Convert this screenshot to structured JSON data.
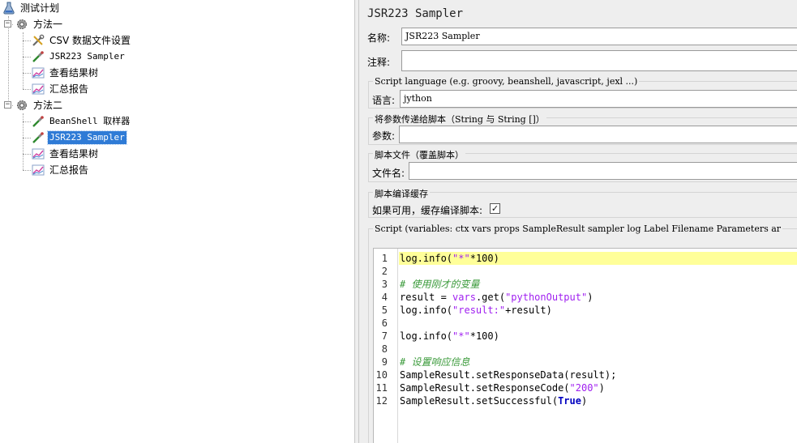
{
  "tree": {
    "root": {
      "label": "测试计划",
      "icon": "flask-icon"
    },
    "groups": [
      {
        "label": "方法一",
        "icon": "gear-icon",
        "expanded": true,
        "children": [
          {
            "label": "CSV 数据文件设置",
            "icon": "wrench-scissors-icon"
          },
          {
            "label": "JSR223 Sampler",
            "icon": "pipette-icon"
          },
          {
            "label": "查看结果树",
            "icon": "graph-icon"
          },
          {
            "label": "汇总报告",
            "icon": "graph-icon"
          }
        ]
      },
      {
        "label": "方法二",
        "icon": "gear-icon",
        "expanded": true,
        "children": [
          {
            "label": "BeanShell 取样器",
            "icon": "pipette-icon"
          },
          {
            "label": "JSR223 Sampler",
            "icon": "pipette-icon",
            "selected": true
          },
          {
            "label": "查看结果树",
            "icon": "graph-icon"
          },
          {
            "label": "汇总报告",
            "icon": "graph-icon"
          }
        ]
      }
    ]
  },
  "panel": {
    "title": "JSR223 Sampler",
    "name_label": "名称:",
    "name_value": "JSR223 Sampler",
    "comment_label": "注释:",
    "comment_value": "",
    "script_language_title": "Script language (e.g. groovy, beanshell, javascript, jexl ...)",
    "language_label": "语言:",
    "language_value": "jython",
    "params_title": "将参数传递给脚本（String 与 String []）",
    "params_label": "参数:",
    "params_value": "",
    "script_file_title": "脚本文件（覆盖脚本）",
    "file_label": "文件名:",
    "file_value": "",
    "cache_title": "脚本编译缓存",
    "cache_label": "如果可用，缓存编译脚本:",
    "cache_checked": true,
    "script_title": "Script (variables: ctx vars props SampleResult sampler log Label Filename Parameters ar"
  },
  "editor": {
    "current_line": 1,
    "line_numbers": [
      "1",
      "2",
      "3",
      "4",
      "5",
      "6",
      "7",
      "8",
      "9",
      "10",
      "11",
      "12"
    ],
    "lines": [
      [
        {
          "t": "pl",
          "v": "log.info("
        },
        {
          "t": "str",
          "v": "\"*\""
        },
        {
          "t": "pl",
          "v": "*100)"
        }
      ],
      [],
      [
        {
          "t": "cmt",
          "v": "# 使用刚才的变量"
        }
      ],
      [
        {
          "t": "pl",
          "v": "result = "
        },
        {
          "t": "str",
          "v": "vars"
        },
        {
          "t": "pl",
          "v": ".get("
        },
        {
          "t": "str",
          "v": "\"pythonOutput\""
        },
        {
          "t": "pl",
          "v": ")"
        }
      ],
      [
        {
          "t": "pl",
          "v": "log.info("
        },
        {
          "t": "str",
          "v": "\"result:\""
        },
        {
          "t": "pl",
          "v": "+result)"
        }
      ],
      [],
      [
        {
          "t": "pl",
          "v": "log.info("
        },
        {
          "t": "str",
          "v": "\"*\""
        },
        {
          "t": "pl",
          "v": "*100)"
        }
      ],
      [],
      [
        {
          "t": "cmt",
          "v": "# 设置响应信息"
        }
      ],
      [
        {
          "t": "pl",
          "v": "SampleResult.setResponseData(result);"
        }
      ],
      [
        {
          "t": "pl",
          "v": "SampleResult.setResponseCode("
        },
        {
          "t": "str",
          "v": "\"200\""
        },
        {
          "t": "pl",
          "v": ")"
        }
      ],
      [
        {
          "t": "pl",
          "v": "SampleResult.setSuccessful("
        },
        {
          "t": "kw",
          "v": "True"
        },
        {
          "t": "pl",
          "v": ")"
        }
      ]
    ]
  }
}
